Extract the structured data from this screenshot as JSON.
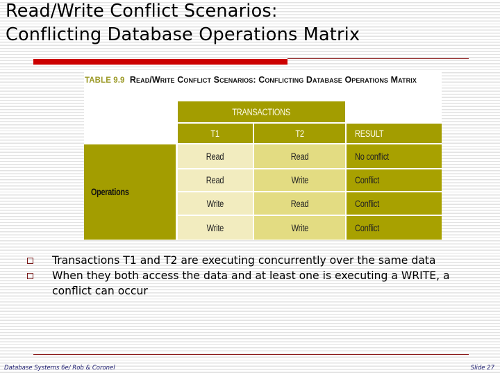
{
  "slide": {
    "title_lines": [
      "Read/Write Conflict Scenarios:",
      "Conflicting Database Operations Matrix"
    ],
    "accent_color": "#cc0000",
    "rule_color": "#8b1a1a"
  },
  "table": {
    "caption_number": "TABLE 9.9",
    "caption_text": "Read/Write Conflict Scenarios: Conflicting Database Operations Matrix",
    "group_header": "TRANSACTIONS",
    "columns": [
      "T1",
      "T2",
      "RESULT"
    ],
    "row_header": "Operations",
    "rows": [
      {
        "t1": "Read",
        "t2": "Read",
        "result": "No conflict"
      },
      {
        "t1": "Read",
        "t2": "Write",
        "result": "Conflict"
      },
      {
        "t1": "Write",
        "t2": "Read",
        "result": "Conflict"
      },
      {
        "t1": "Write",
        "t2": "Write",
        "result": "Conflict"
      }
    ],
    "colors": {
      "header": "#a39d00",
      "t1": "#f2ecbf",
      "t2": "#e3dc82",
      "result": "#a8a100"
    }
  },
  "bullets": [
    "Transactions T1 and T2 are executing concurrently over the same data",
    "When they both access the data and at least one is executing a WRITE, a conflict can occur"
  ],
  "footer": {
    "left": "Database Systems 6e/ Rob & Coronel",
    "right": "Slide 27"
  }
}
